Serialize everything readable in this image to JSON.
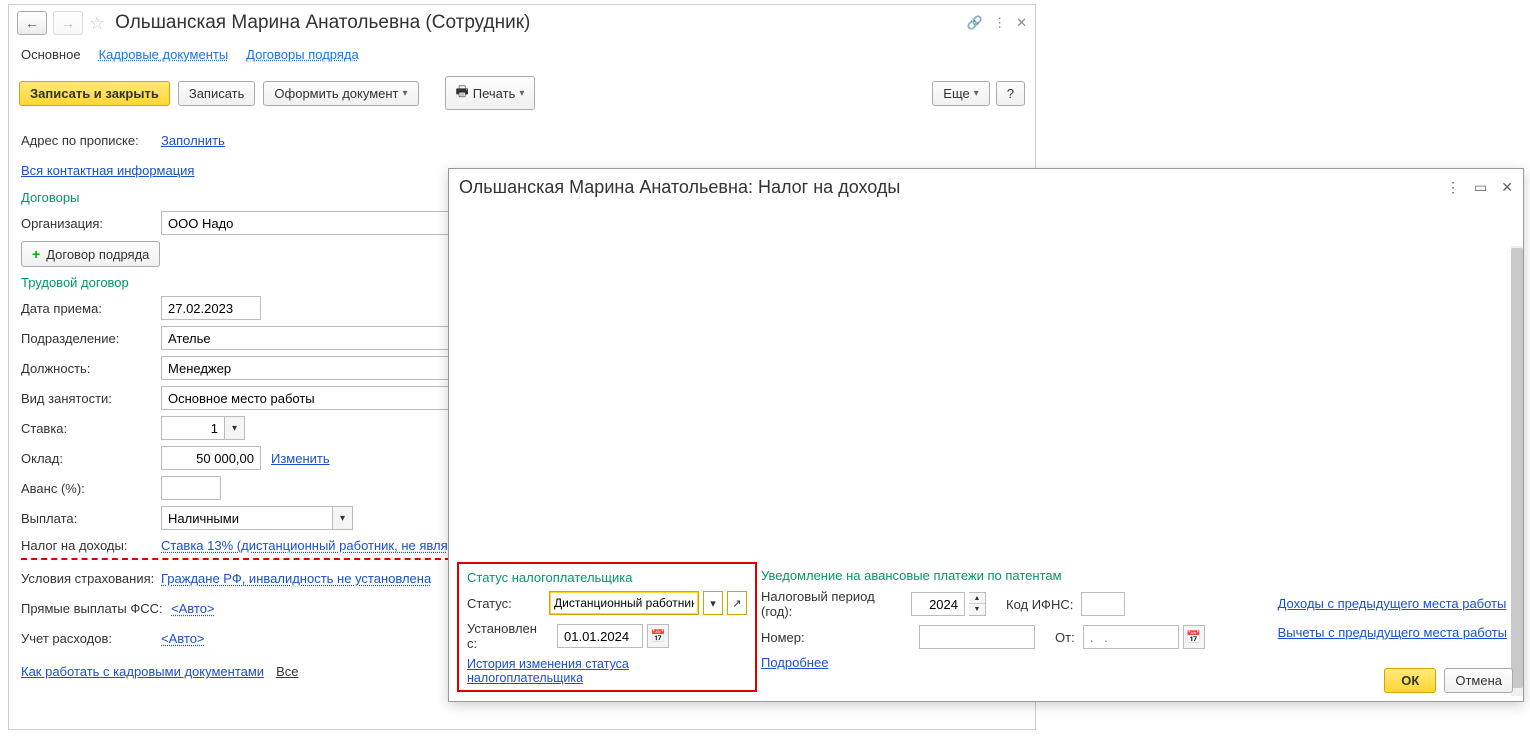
{
  "main": {
    "title": "Ольшанская Марина Анатольевна (Сотрудник)",
    "tabs": {
      "main": "Основное",
      "hr_docs": "Кадровые документы",
      "contracts": "Договоры подряда"
    },
    "toolbar": {
      "save_close": "Записать и закрыть",
      "save": "Записать",
      "create_doc": "Оформить документ",
      "print": "Печать",
      "more": "Еще",
      "help": "?"
    },
    "address_label": "Адрес по прописке:",
    "fill_link": "Заполнить",
    "all_contact_link": "Вся контактная информация",
    "contracts_section": "Договоры",
    "org_label": "Организация:",
    "org_value": "ООО Надо",
    "add_contract": "Договор подряда",
    "labor_section": "Трудовой договор",
    "hire_date_label": "Дата приема:",
    "hire_date_value": "27.02.2023",
    "dept_label": "Подразделение:",
    "dept_value": "Ателье",
    "position_label": "Должность:",
    "position_value": "Менеджер",
    "employment_label": "Вид занятости:",
    "employment_value": "Основное место работы",
    "rate_label": "Ставка:",
    "rate_value": "1",
    "salary_label": "Оклад:",
    "salary_value": "50 000,00",
    "change_link": "Изменить",
    "advance_label": "Аванс (%):",
    "payment_label": "Выплата:",
    "payment_value": "Наличными",
    "tax_label": "Налог на доходы:",
    "tax_value": "Ставка 13% (дистанционный работник, не явля",
    "insurance_label": "Условия страхования:",
    "insurance_value": "Граждане РФ, инвалидность не установлена",
    "fss_label": "Прямые выплаты ФСС:",
    "fss_value": "<Авто>",
    "expenses_label": "Учет расходов:",
    "expenses_value": "<Авто>",
    "footer_howto": "Как работать с кадровыми документами",
    "footer_all": "Все"
  },
  "modal": {
    "title": "Ольшанская Марина Анатольевна: Налог на доходы",
    "taxpayer_section": "Статус налогоплательщика",
    "status_label": "Статус:",
    "status_value": "Дистанционный работник,",
    "set_from_label": "Установлен с:",
    "set_from_value": "01.01.2024",
    "history_link": "История изменения статуса налогоплательщика",
    "notice_section": "Уведомление на авансовые платежи по патентам",
    "tax_period_label": "Налоговый период (год):",
    "tax_period_value": "2024",
    "ifns_label": "Код ИФНС:",
    "number_label": "Номер:",
    "from_label": "От:",
    "from_placeholder": ".   .",
    "more_link": "Подробнее",
    "prev_income_link": "Доходы с предыдущего места работы",
    "prev_deduct_link": "Вычеты с предыдущего места работы",
    "ok": "ОК",
    "cancel": "Отмена"
  }
}
